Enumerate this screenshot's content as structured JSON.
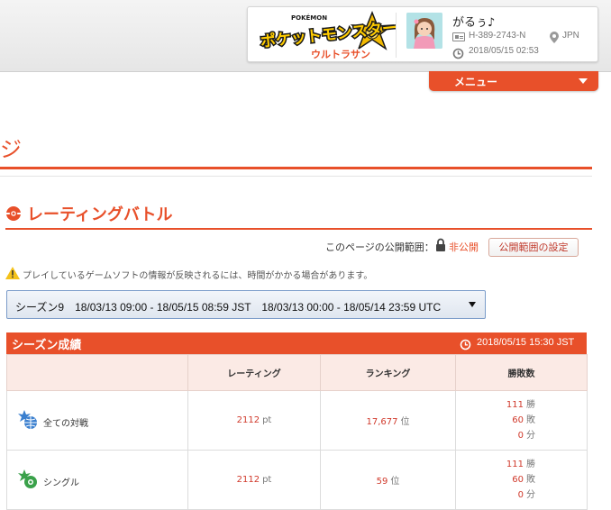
{
  "profile": {
    "game_logo_text": "ポケットモンスター ウルトラサン",
    "game_logo_brand": "POKÉMON",
    "user_name": "がるぅ♪",
    "trainer_id": "H-389-2743-N",
    "country": "JPN",
    "sync_date": "2018/05/15 02:53"
  },
  "menu": {
    "label": "メニュー"
  },
  "page": {
    "heading": "ジ"
  },
  "section": {
    "title": "レーティングバトル"
  },
  "visibility": {
    "label": "このページの公開範囲：",
    "value": "非公開",
    "button_label": "公開範囲の設定"
  },
  "notice": {
    "text": "プレイしているゲームソフトの情報が反映されるには、時間がかかる場合があります。"
  },
  "season_select": {
    "selected": "シーズン9　18/03/13 09:00 - 18/05/15 08:59 JST　18/03/13 00:00 - 18/05/14 23:59 UTC"
  },
  "results": {
    "title": "シーズン成績",
    "updated": "2018/05/15 15:30 JST",
    "columns": [
      "",
      "レーティング",
      "ランキング",
      "勝敗数"
    ],
    "rows": [
      {
        "category": "全ての対戦",
        "icon": "globe-battle-icon",
        "rating": "2112",
        "rating_unit": "pt",
        "ranking": "17,677",
        "ranking_unit": "位",
        "wins": "111",
        "wins_unit": "勝",
        "losses": "60",
        "losses_unit": "敗",
        "draws": "0",
        "draws_unit": "分"
      },
      {
        "category": "シングル",
        "icon": "single-battle-icon",
        "rating": "2112",
        "rating_unit": "pt",
        "ranking": "59",
        "ranking_unit": "位",
        "wins": "111",
        "wins_unit": "勝",
        "losses": "60",
        "losses_unit": "敗",
        "draws": "0",
        "draws_unit": "分"
      }
    ]
  },
  "colors": {
    "accent": "#e8502a",
    "header_bg": "#fbeae5",
    "select_border": "#7b9cc9"
  }
}
